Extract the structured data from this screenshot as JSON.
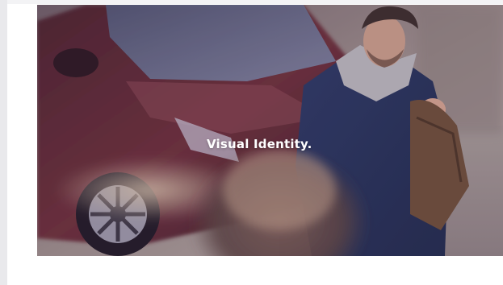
{
  "hero": {
    "title": "Visual Identity.",
    "image_subject": "photo of a man in a navy jacket carrying a leather bag beside a dark red car, with a blurred woman with flowing hair in the foreground"
  },
  "colors": {
    "car_body": "#5b2a32",
    "jacket": "#2c3a63",
    "background_ground": "#8c8080",
    "title_text": "#ffffff"
  }
}
